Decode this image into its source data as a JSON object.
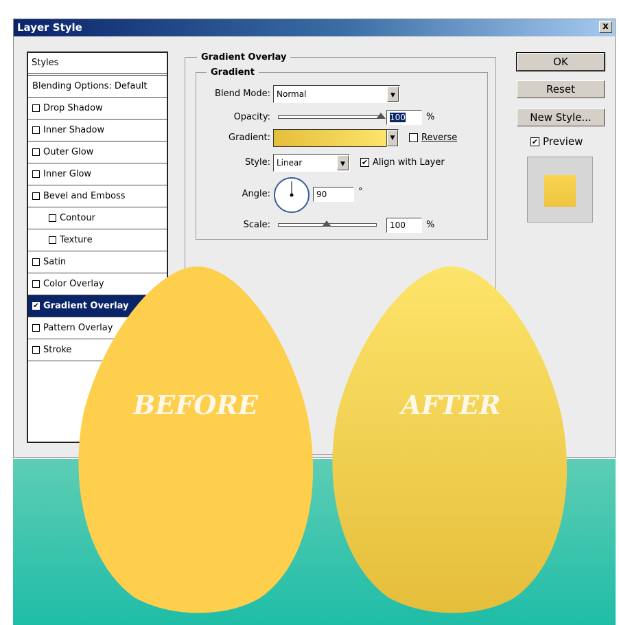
{
  "dialog": {
    "title": "Layer Style",
    "close_label": "x"
  },
  "styles_list": {
    "header": "Styles",
    "items": [
      {
        "label": "Blending Options: Default",
        "checkbox": false,
        "checked": false
      },
      {
        "label": "Drop Shadow",
        "checkbox": true,
        "checked": false
      },
      {
        "label": "Inner Shadow",
        "checkbox": true,
        "checked": false
      },
      {
        "label": "Outer Glow",
        "checkbox": true,
        "checked": false
      },
      {
        "label": "Inner Glow",
        "checkbox": true,
        "checked": false
      },
      {
        "label": "Bevel and Emboss",
        "checkbox": true,
        "checked": false
      },
      {
        "label": "Contour",
        "checkbox": true,
        "checked": false
      },
      {
        "label": "Texture",
        "checkbox": true,
        "checked": false
      },
      {
        "label": "Satin",
        "checkbox": true,
        "checked": false
      },
      {
        "label": "Color Overlay",
        "checkbox": true,
        "checked": false
      },
      {
        "label": "Gradient Overlay",
        "checkbox": true,
        "checked": true
      },
      {
        "label": "Pattern Overlay",
        "checkbox": true,
        "checked": false
      },
      {
        "label": "Stroke",
        "checkbox": true,
        "checked": false
      }
    ]
  },
  "gradient_overlay": {
    "group_title": "Gradient Overlay",
    "subgroup_title": "Gradient",
    "blend_mode": {
      "label": "Blend Mode:",
      "value": "Normal"
    },
    "opacity": {
      "label": "Opacity:",
      "value": "100",
      "unit": "%",
      "level": 1.0
    },
    "gradient": {
      "label": "Gradient:",
      "reverse_label": "Reverse",
      "reverse_checked": false,
      "start_color": "#e5be3b",
      "end_color": "#fde46a"
    },
    "style": {
      "label": "Style:",
      "value": "Linear",
      "align_label": "Align with Layer",
      "align_checked": true
    },
    "angle": {
      "label": "Angle:",
      "value": "90",
      "unit": "°"
    },
    "scale": {
      "label": "Scale:",
      "value": "100",
      "unit": "%",
      "level": 0.5
    }
  },
  "buttons": {
    "ok": "OK",
    "reset": "Reset",
    "new_style": "New Style...",
    "preview_label": "Preview",
    "preview_checked": true
  },
  "overlay": {
    "before_label": "BEFORE",
    "after_label": "AFTER",
    "before_color": "#fdcf4c",
    "after_colors": [
      "#fde46a",
      "#e5be3b"
    ],
    "background_color": "#1fbda7"
  },
  "icons": {
    "checkbox_checked": "✔",
    "dropdown_arrow": "▼"
  }
}
